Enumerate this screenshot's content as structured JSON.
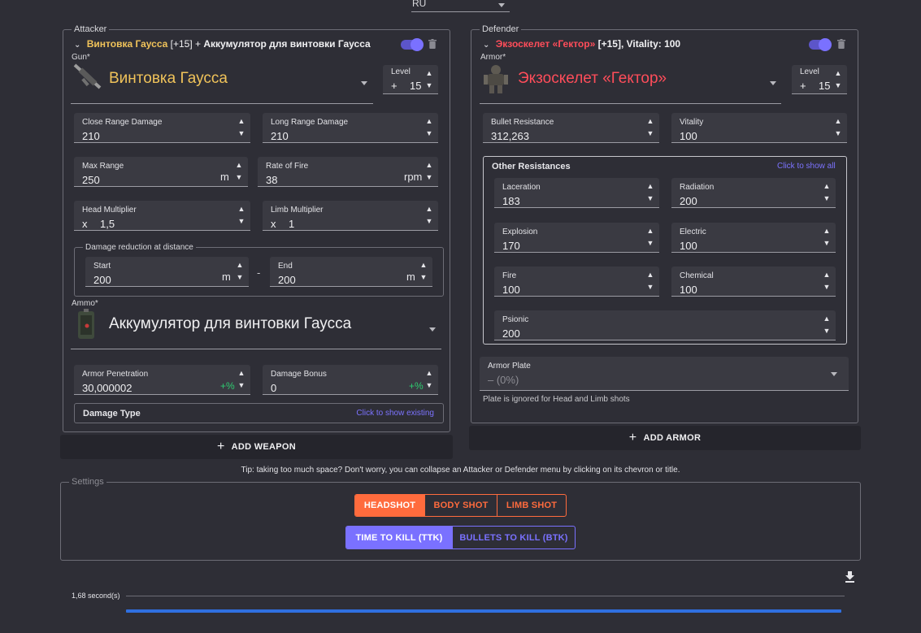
{
  "language": {
    "value": "RU"
  },
  "attacker": {
    "legend": "Attacker",
    "title_gun": "Винтовка Гаусса",
    "title_level": " [+15] + ",
    "title_ammo": "Аккумулятор для винтовки Гаусса",
    "gun_label": "Gun*",
    "gun_name": "Винтовка Гаусса",
    "level_label": "Level",
    "level_plus": "+",
    "level_value": "15",
    "close_range_label": "Close Range Damage",
    "close_range_value": "210",
    "long_range_label": "Long Range Damage",
    "long_range_value": "210",
    "max_range_label": "Max Range",
    "max_range_value": "250",
    "max_range_unit": "m",
    "rof_label": "Rate of Fire",
    "rof_value": "38",
    "rof_unit": "rpm",
    "head_mult_label": "Head Multiplier",
    "head_mult_prefix": "x",
    "head_mult_value": "1,5",
    "limb_mult_label": "Limb Multiplier",
    "limb_mult_prefix": "x",
    "limb_mult_value": "1",
    "reduction_legend": "Damage reduction at distance",
    "start_label": "Start",
    "start_value": "200",
    "start_unit": "m",
    "dash": "-",
    "end_label": "End",
    "end_value": "200",
    "end_unit": "m",
    "ammo_label": "Ammo*",
    "ammo_name": "Аккумулятор для винтовки Гаусса",
    "armor_pen_label": "Armor Penetration",
    "armor_pen_value": "30,000002",
    "armor_pen_pct": "+%",
    "damage_bonus_label": "Damage Bonus",
    "damage_bonus_value": "0",
    "damage_bonus_pct": "+%",
    "damage_type_label": "Damage Type",
    "damage_type_link": "Click to show existing",
    "add_button": "ADD WEAPON"
  },
  "defender": {
    "legend": "Defender",
    "title_armor": "Экзоскелет «Гектор»",
    "title_rest": " [+15], Vitality: 100",
    "armor_label": "Armor*",
    "armor_name": "Экзоскелет «Гектор»",
    "level_label": "Level",
    "level_plus": "+",
    "level_value": "15",
    "bullet_res_label": "Bullet Resistance",
    "bullet_res_value": "312,263",
    "vitality_label": "Vitality",
    "vitality_value": "100",
    "other_title": "Other Resistances",
    "other_link": "Click to show all",
    "laceration_label": "Laceration",
    "laceration_value": "183",
    "radiation_label": "Radiation",
    "radiation_value": "200",
    "explosion_label": "Explosion",
    "explosion_value": "170",
    "electric_label": "Electric",
    "electric_value": "100",
    "fire_label": "Fire",
    "fire_value": "100",
    "chemical_label": "Chemical",
    "chemical_value": "100",
    "psionic_label": "Psionic",
    "psionic_value": "200",
    "plate_label": "Armor Plate",
    "plate_value": "– (0%)",
    "plate_hint": "Plate is ignored for Head and Limb shots",
    "add_button": "ADD ARMOR"
  },
  "tip": "Tip: taking too much space? Don't worry, you can collapse an Attacker or Defender menu by clicking on its chevron or title.",
  "settings": {
    "legend": "Settings",
    "shots": [
      "HEADSHOT",
      "BODY SHOT",
      "LIMB SHOT"
    ],
    "modes": [
      "TIME TO KILL (TTK)",
      "BULLETS TO KILL (BTK)"
    ]
  },
  "result": {
    "label": "1,68 second(s)",
    "progress": 1.0
  },
  "colors": {
    "gun": "#f0c35a",
    "armor": "#ff4d5a",
    "accent": "#7a71ff",
    "shot": "#ff6b3d",
    "bar": "#2f6fe0"
  }
}
